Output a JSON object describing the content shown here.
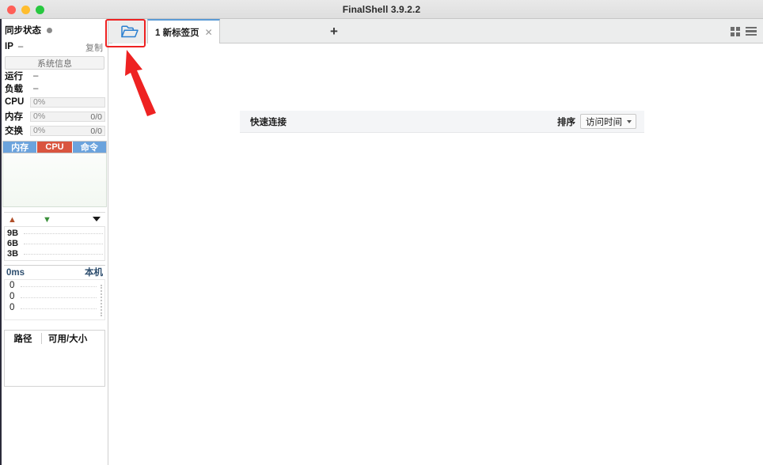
{
  "window": {
    "title": "FinalShell 3.9.2.2",
    "controls": [
      "close",
      "minimize",
      "maximize"
    ]
  },
  "sidebar": {
    "sync": {
      "label": "同步状态",
      "status_icon": "status-dot"
    },
    "ip": {
      "label": "IP",
      "value": "–",
      "copy_label": "复制"
    },
    "sysinfo_button": "系统信息",
    "stats": [
      {
        "key": "运行",
        "value": "–"
      },
      {
        "key": "负载",
        "value": "–"
      }
    ],
    "meters": [
      {
        "name": "CPU",
        "percent": "0%",
        "detail": ""
      },
      {
        "name": "内存",
        "percent": "0%",
        "detail": "0/0"
      },
      {
        "name": "交换",
        "percent": "0%",
        "detail": "0/0"
      }
    ],
    "graph_tabs": [
      {
        "label": "内存",
        "active": false
      },
      {
        "label": "CPU",
        "active": true
      },
      {
        "label": "命令",
        "active": false
      }
    ],
    "network": {
      "up_icon": "arrow-up-icon",
      "down_icon": "arrow-down-icon",
      "menu_icon": "caret-down-icon",
      "y_labels": [
        "9B",
        "6B",
        "3B"
      ]
    },
    "latency": {
      "value": "0ms",
      "host": "本机",
      "y_labels": [
        "0",
        "0",
        "0"
      ]
    },
    "disk": {
      "columns": [
        "路径",
        "可用/大小"
      ],
      "rows": []
    }
  },
  "tabbar": {
    "folder_button_icon": "open-folder-icon",
    "tabs": [
      {
        "index": "1",
        "label": "新标签页",
        "close_icon": "close-icon",
        "active": true
      }
    ],
    "new_tab_label": "+",
    "view_grid_icon": "grid-view-icon",
    "view_list_icon": "list-view-icon"
  },
  "main": {
    "quick_connect": {
      "title": "快速连接",
      "sort_label": "排序",
      "sort_value": "访问时间",
      "sort_options": [
        "访问时间"
      ]
    },
    "items": []
  },
  "annotation": {
    "highlight_color": "#ee2222",
    "target": "open-folder-icon",
    "arrow_icon": "pointer-arrow-icon"
  },
  "tab_display": {
    "tab1": "1 新标签页"
  }
}
